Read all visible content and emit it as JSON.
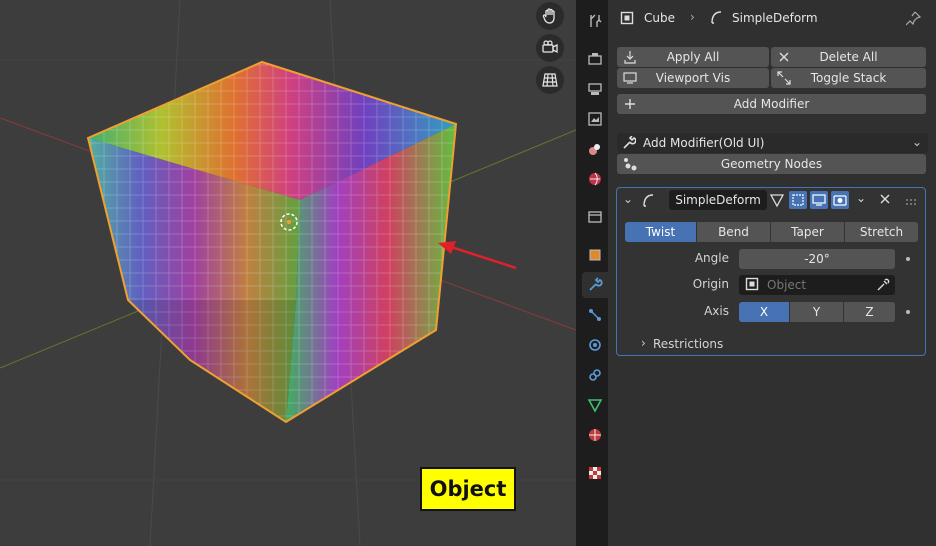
{
  "viewport": {
    "mode_label": "Object",
    "tools": [
      "hand-icon",
      "camera-icon",
      "grid-icon"
    ]
  },
  "colors": {
    "accent": "#4772b3",
    "object_label_bg": "#ffff00",
    "arrow": "#e0202a",
    "selection_outline": "#f0a030"
  },
  "header": {
    "object_name": "Cube",
    "modifier_name": "SimpleDeform"
  },
  "toolbar": {
    "apply_all": "Apply All",
    "delete_all": "Delete All",
    "viewport_vis": "Viewport Vis",
    "toggle_stack": "Toggle Stack",
    "add_modifier": "Add Modifier",
    "add_modifier_old": "Add Modifier(Old UI)",
    "geometry_nodes": "Geometry Nodes"
  },
  "modifier": {
    "name": "SimpleDeform",
    "methods": [
      "Twist",
      "Bend",
      "Taper",
      "Stretch"
    ],
    "selected_method": "Twist",
    "angle_label": "Angle",
    "angle_value": "-20°",
    "origin_label": "Origin",
    "origin_placeholder": "Object",
    "axis_label": "Axis",
    "axes": [
      "X",
      "Y",
      "Z"
    ],
    "selected_axis": "X",
    "restrictions_label": "Restrictions"
  },
  "sidebar_tabs": [
    "tool",
    "render",
    "output",
    "view-layer",
    "scene",
    "world",
    "collection",
    "object",
    "modifiers",
    "particles",
    "physics",
    "constraints",
    "data",
    "material",
    "texture"
  ]
}
